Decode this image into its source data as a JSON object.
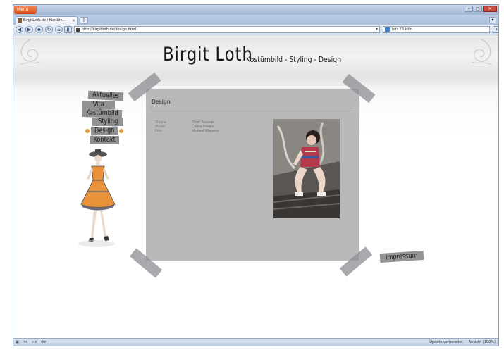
{
  "browser": {
    "app_button": "Menü",
    "tab_title": "BirgitLoth.de / Kostüm...",
    "url": "http://birgitloth.de/design.html",
    "search_text": "bds.28 köln",
    "status_right_1": "Update verbereitet",
    "status_right_2": "Ansicht (100%)"
  },
  "site": {
    "title": "Birgit Loth",
    "subtitle": "Kostümbild - Styling - Design",
    "nav": [
      "Aktuelles",
      "Vita",
      "Kostümbild",
      "Styling",
      "Design",
      "Kontakt"
    ],
    "active_nav": "Design",
    "impressum": "Impressum"
  },
  "content": {
    "heading": "Design",
    "credits": [
      {
        "label": "Thema",
        "value": "Short Summer"
      },
      {
        "label": "Model",
        "value": "Corina Pesiev"
      },
      {
        "label": "Foto",
        "value": "Michael Wagener"
      }
    ]
  },
  "colors": {
    "accent": "#e79a3b",
    "card_bg": "#b7b9bb",
    "dress": "#e8923a"
  }
}
